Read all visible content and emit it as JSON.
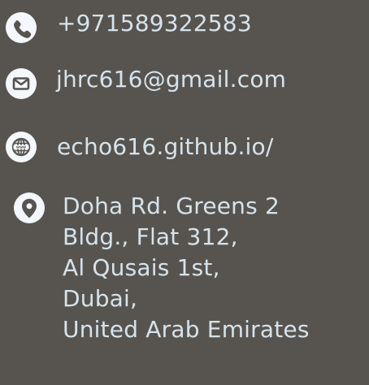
{
  "contact": {
    "phone": {
      "icon": "phone-icon",
      "text": "+971589322583"
    },
    "email": {
      "icon": "envelope-icon",
      "text": "jhrc616@gmail.com"
    },
    "website": {
      "icon": "globe-www-icon",
      "text": "echo616.github.io/"
    },
    "address": {
      "icon": "location-pin-icon",
      "lines": [
        "Doha Rd. Greens 2",
        "Bldg., Flat 312,",
        "Al Qusais 1st,",
        "Dubai,",
        "United Arab Emirates"
      ]
    }
  },
  "colors": {
    "background": "#57544f",
    "text": "#d6e3ec",
    "icon_bg": "#f4f7fb",
    "icon_fg": "#57544f"
  }
}
